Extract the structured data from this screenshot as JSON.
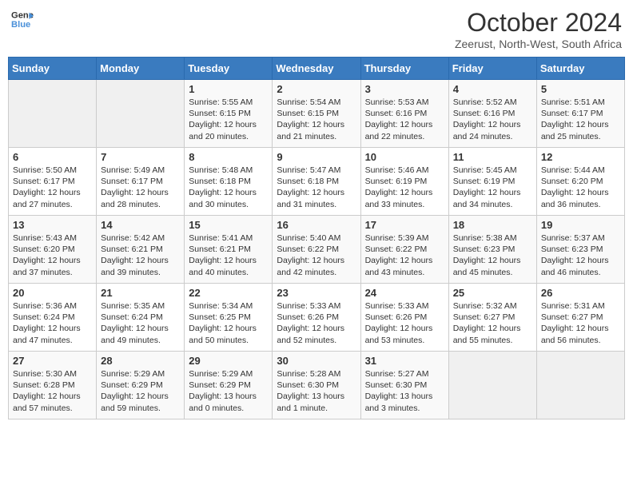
{
  "logo": {
    "line1": "General",
    "line2": "Blue",
    "icon": "▶"
  },
  "title": "October 2024",
  "subtitle": "Zeerust, North-West, South Africa",
  "weekdays": [
    "Sunday",
    "Monday",
    "Tuesday",
    "Wednesday",
    "Thursday",
    "Friday",
    "Saturday"
  ],
  "weeks": [
    [
      {
        "day": "",
        "info": ""
      },
      {
        "day": "",
        "info": ""
      },
      {
        "day": "1",
        "info": "Sunrise: 5:55 AM\nSunset: 6:15 PM\nDaylight: 12 hours and 20 minutes."
      },
      {
        "day": "2",
        "info": "Sunrise: 5:54 AM\nSunset: 6:15 PM\nDaylight: 12 hours and 21 minutes."
      },
      {
        "day": "3",
        "info": "Sunrise: 5:53 AM\nSunset: 6:16 PM\nDaylight: 12 hours and 22 minutes."
      },
      {
        "day": "4",
        "info": "Sunrise: 5:52 AM\nSunset: 6:16 PM\nDaylight: 12 hours and 24 minutes."
      },
      {
        "day": "5",
        "info": "Sunrise: 5:51 AM\nSunset: 6:17 PM\nDaylight: 12 hours and 25 minutes."
      }
    ],
    [
      {
        "day": "6",
        "info": "Sunrise: 5:50 AM\nSunset: 6:17 PM\nDaylight: 12 hours and 27 minutes."
      },
      {
        "day": "7",
        "info": "Sunrise: 5:49 AM\nSunset: 6:17 PM\nDaylight: 12 hours and 28 minutes."
      },
      {
        "day": "8",
        "info": "Sunrise: 5:48 AM\nSunset: 6:18 PM\nDaylight: 12 hours and 30 minutes."
      },
      {
        "day": "9",
        "info": "Sunrise: 5:47 AM\nSunset: 6:18 PM\nDaylight: 12 hours and 31 minutes."
      },
      {
        "day": "10",
        "info": "Sunrise: 5:46 AM\nSunset: 6:19 PM\nDaylight: 12 hours and 33 minutes."
      },
      {
        "day": "11",
        "info": "Sunrise: 5:45 AM\nSunset: 6:19 PM\nDaylight: 12 hours and 34 minutes."
      },
      {
        "day": "12",
        "info": "Sunrise: 5:44 AM\nSunset: 6:20 PM\nDaylight: 12 hours and 36 minutes."
      }
    ],
    [
      {
        "day": "13",
        "info": "Sunrise: 5:43 AM\nSunset: 6:20 PM\nDaylight: 12 hours and 37 minutes."
      },
      {
        "day": "14",
        "info": "Sunrise: 5:42 AM\nSunset: 6:21 PM\nDaylight: 12 hours and 39 minutes."
      },
      {
        "day": "15",
        "info": "Sunrise: 5:41 AM\nSunset: 6:21 PM\nDaylight: 12 hours and 40 minutes."
      },
      {
        "day": "16",
        "info": "Sunrise: 5:40 AM\nSunset: 6:22 PM\nDaylight: 12 hours and 42 minutes."
      },
      {
        "day": "17",
        "info": "Sunrise: 5:39 AM\nSunset: 6:22 PM\nDaylight: 12 hours and 43 minutes."
      },
      {
        "day": "18",
        "info": "Sunrise: 5:38 AM\nSunset: 6:23 PM\nDaylight: 12 hours and 45 minutes."
      },
      {
        "day": "19",
        "info": "Sunrise: 5:37 AM\nSunset: 6:23 PM\nDaylight: 12 hours and 46 minutes."
      }
    ],
    [
      {
        "day": "20",
        "info": "Sunrise: 5:36 AM\nSunset: 6:24 PM\nDaylight: 12 hours and 47 minutes."
      },
      {
        "day": "21",
        "info": "Sunrise: 5:35 AM\nSunset: 6:24 PM\nDaylight: 12 hours and 49 minutes."
      },
      {
        "day": "22",
        "info": "Sunrise: 5:34 AM\nSunset: 6:25 PM\nDaylight: 12 hours and 50 minutes."
      },
      {
        "day": "23",
        "info": "Sunrise: 5:33 AM\nSunset: 6:26 PM\nDaylight: 12 hours and 52 minutes."
      },
      {
        "day": "24",
        "info": "Sunrise: 5:33 AM\nSunset: 6:26 PM\nDaylight: 12 hours and 53 minutes."
      },
      {
        "day": "25",
        "info": "Sunrise: 5:32 AM\nSunset: 6:27 PM\nDaylight: 12 hours and 55 minutes."
      },
      {
        "day": "26",
        "info": "Sunrise: 5:31 AM\nSunset: 6:27 PM\nDaylight: 12 hours and 56 minutes."
      }
    ],
    [
      {
        "day": "27",
        "info": "Sunrise: 5:30 AM\nSunset: 6:28 PM\nDaylight: 12 hours and 57 minutes."
      },
      {
        "day": "28",
        "info": "Sunrise: 5:29 AM\nSunset: 6:29 PM\nDaylight: 12 hours and 59 minutes."
      },
      {
        "day": "29",
        "info": "Sunrise: 5:29 AM\nSunset: 6:29 PM\nDaylight: 13 hours and 0 minutes."
      },
      {
        "day": "30",
        "info": "Sunrise: 5:28 AM\nSunset: 6:30 PM\nDaylight: 13 hours and 1 minute."
      },
      {
        "day": "31",
        "info": "Sunrise: 5:27 AM\nSunset: 6:30 PM\nDaylight: 13 hours and 3 minutes."
      },
      {
        "day": "",
        "info": ""
      },
      {
        "day": "",
        "info": ""
      }
    ]
  ]
}
